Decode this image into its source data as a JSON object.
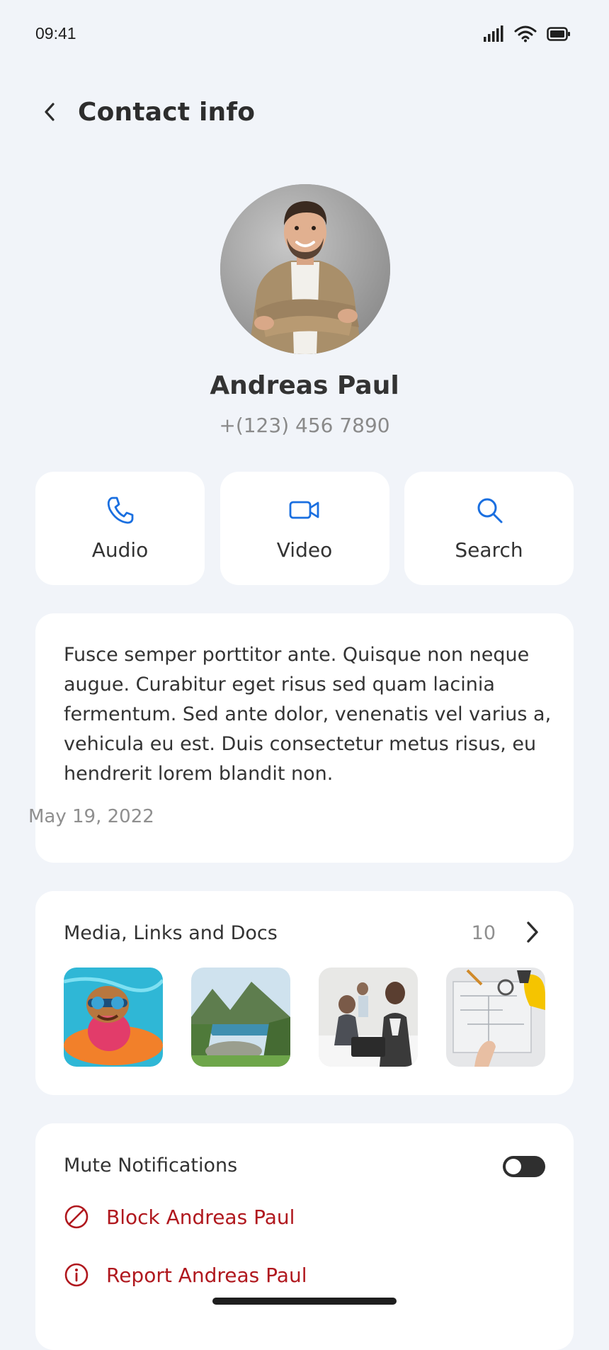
{
  "status_bar": {
    "time": "09:41"
  },
  "header": {
    "title": "Contact info"
  },
  "contact": {
    "name": "Andreas Paul",
    "phone": "+(123) 456 7890"
  },
  "actions": [
    {
      "label": "Audio",
      "icon": "phone-icon"
    },
    {
      "label": "Video",
      "icon": "video-camera-icon"
    },
    {
      "label": "Search",
      "icon": "search-icon"
    }
  ],
  "about": {
    "text": "Fusce semper porttitor ante. Quisque non neque augue. Curabitur eget risus sed quam lacinia fermentum. Sed ante dolor, venenatis vel varius a, vehicula eu est. Duis consectetur metus risus, eu hendrerit lorem blandit non.",
    "date": "May 19, 2022"
  },
  "media": {
    "title": "Media, Links and Docs",
    "count": "10"
  },
  "settings": {
    "mute_label": "Mute Notifications",
    "mute_on": false,
    "block_label": "Block Andreas Paul",
    "report_label": "Report Andreas Paul"
  },
  "colors": {
    "accent": "#1A6FE0",
    "danger": "#B0181E",
    "background": "#F1F4F9",
    "card": "#FFFFFF"
  }
}
